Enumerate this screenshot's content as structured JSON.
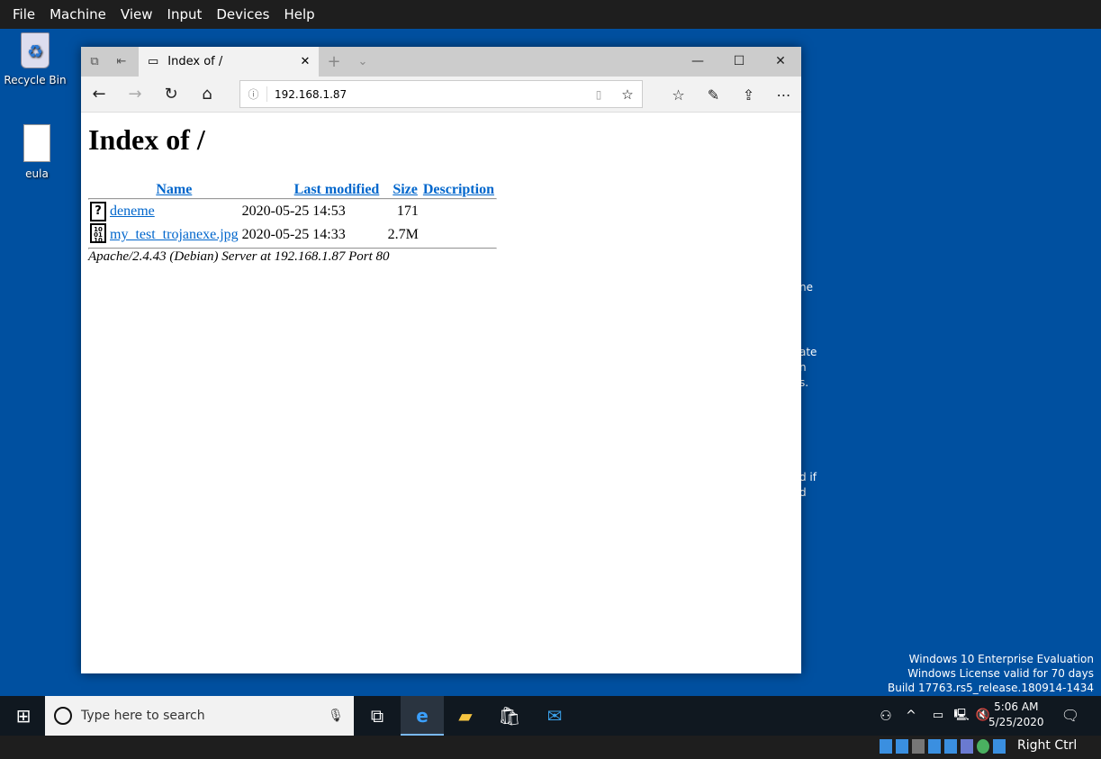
{
  "menubar": [
    "File",
    "Machine",
    "View",
    "Input",
    "Devices",
    "Help"
  ],
  "desktop": {
    "icons": [
      {
        "label": "Recycle Bin",
        "icon": "recycle-bin-icon"
      },
      {
        "label": "eula",
        "icon": "text-file-shortcut-icon"
      }
    ],
    "fragments": [
      "ne",
      "ate",
      "n",
      "s.",
      "d if",
      "d"
    ]
  },
  "browser": {
    "tab_title": "Index of /",
    "url": "192.168.1.87",
    "page": {
      "heading": "Index of /",
      "columns": [
        "Name",
        "Last modified",
        "Size",
        "Description"
      ],
      "rows": [
        {
          "icon": "unknown-file-icon",
          "name": "deneme",
          "modified": "2020-05-25 14:53",
          "size": "171",
          "description": ""
        },
        {
          "icon": "binary-file-icon",
          "name": "my_test_trojanexe.jpg",
          "modified": "2020-05-25 14:33",
          "size": "2.7M",
          "description": ""
        }
      ],
      "footer": "Apache/2.4.43 (Debian) Server at 192.168.1.87 Port 80"
    }
  },
  "watermark": [
    "Windows 10 Enterprise Evaluation",
    "Windows License valid for 70 days",
    "Build 17763.rs5_release.180914-1434"
  ],
  "taskbar": {
    "search_placeholder": "Type here to search",
    "time": "5:06 AM",
    "date": "5/25/2020"
  },
  "vbox_status": {
    "host_key": "Right Ctrl"
  }
}
